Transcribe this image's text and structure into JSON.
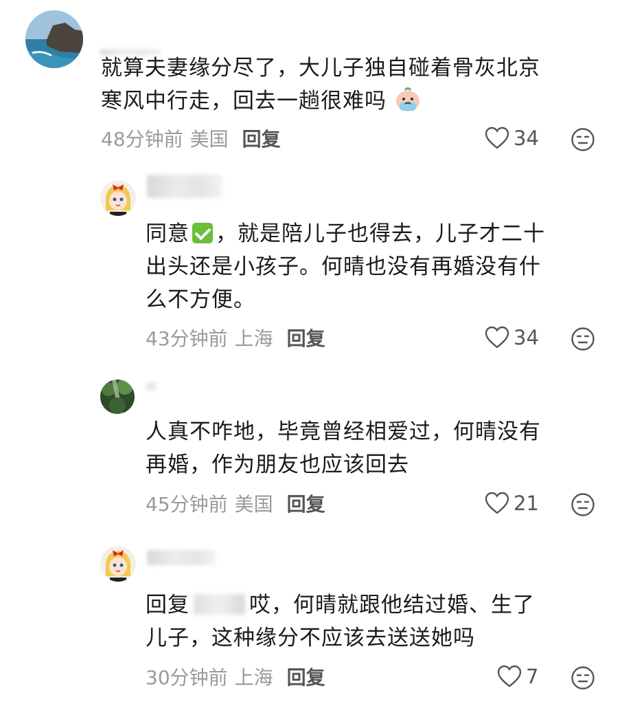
{
  "comments": [
    {
      "text_line1": "就算夫妻缘分尽了，大儿子独自碰着骨灰北京",
      "text_line2": "寒风中行走，回去一趟很难吗",
      "emoji": "crying-face-emoji",
      "time": "48分钟前",
      "location": "美国",
      "reply_label": "回复",
      "likes": "34"
    },
    {
      "text_prefix": "同意",
      "text_after_check": "，就是陪儿子也得去，儿子才二十",
      "text_line2": "出头还是小孩子。何晴也没有再婚没有什",
      "text_line3": "么不方便。",
      "time": "43分钟前",
      "location": "上海",
      "reply_label": "回复",
      "likes": "34"
    },
    {
      "text_line1": "人真不咋地，毕竟曾经相爱过，何晴没有",
      "text_line2": "再婚，作为朋友也应该回去",
      "time": "45分钟前",
      "location": "美国",
      "reply_label": "回复",
      "likes": "21"
    },
    {
      "reply_prefix": "回复",
      "text_line1": "哎，何晴就跟他结过婚、生了",
      "text_line2": "儿子，这种缘分不应该去送送她吗",
      "time": "30分钟前",
      "location": "上海",
      "reply_label": "回复",
      "likes": "7"
    }
  ],
  "icons": {
    "like": "heart-outline-icon",
    "dislike": "meh-face-icon",
    "check": "green-check-icon"
  },
  "colors": {
    "meta_text": "#9a9a9a",
    "reply_text": "#555555",
    "check_green": "#6bbf3a"
  }
}
